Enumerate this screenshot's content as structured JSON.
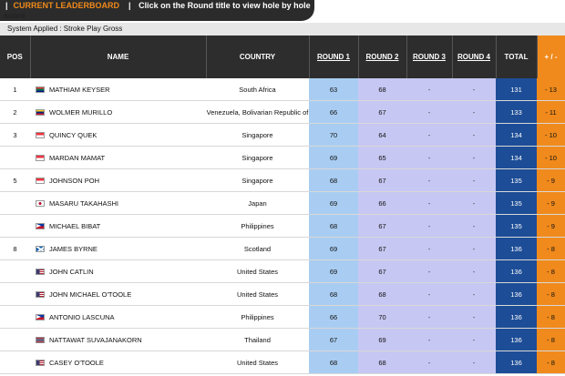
{
  "header": {
    "pipe": "|",
    "title": "CURRENT LEADERBOARD",
    "sep": "|",
    "hint_line1": "Click on the Round title to view hole by hole",
    "hint_line2": "score"
  },
  "system_applied": "System Applied : Stroke Play Gross",
  "columns": {
    "pos": "POS",
    "name": "NAME",
    "country": "COUNTRY",
    "r1": "ROUND 1",
    "r2": "ROUND 2",
    "r3": "ROUND 3",
    "r4": "ROUND 4",
    "total": "TOTAL",
    "pm": "+ / -"
  },
  "rows": [
    {
      "pos": "1",
      "flag": "za",
      "name": "MATHIAM KEYSER",
      "country": "South Africa",
      "r1": "63",
      "r2": "68",
      "r3": "-",
      "r4": "-",
      "total": "131",
      "pm": "- 13"
    },
    {
      "pos": "2",
      "flag": "ve",
      "name": "WOLMER MURILLO",
      "country": "Venezuela, Bolivarian Republic of",
      "r1": "66",
      "r2": "67",
      "r3": "-",
      "r4": "-",
      "total": "133",
      "pm": "- 11"
    },
    {
      "pos": "3",
      "flag": "sg",
      "name": "QUINCY QUEK",
      "country": "Singapore",
      "r1": "70",
      "r2": "64",
      "r3": "-",
      "r4": "-",
      "total": "134",
      "pm": "- 10"
    },
    {
      "pos": "",
      "flag": "sg",
      "name": "MARDAN MAMAT",
      "country": "Singapore",
      "r1": "69",
      "r2": "65",
      "r3": "-",
      "r4": "-",
      "total": "134",
      "pm": "- 10"
    },
    {
      "pos": "5",
      "flag": "sg",
      "name": "JOHNSON POH",
      "country": "Singapore",
      "r1": "68",
      "r2": "67",
      "r3": "-",
      "r4": "-",
      "total": "135",
      "pm": "- 9"
    },
    {
      "pos": "",
      "flag": "jp",
      "name": "MASARU TAKAHASHI",
      "country": "Japan",
      "r1": "69",
      "r2": "66",
      "r3": "-",
      "r4": "-",
      "total": "135",
      "pm": "- 9"
    },
    {
      "pos": "",
      "flag": "ph",
      "name": "MICHAEL BIBAT",
      "country": "Philippines",
      "r1": "68",
      "r2": "67",
      "r3": "-",
      "r4": "-",
      "total": "135",
      "pm": "- 9"
    },
    {
      "pos": "8",
      "flag": "gb-sct",
      "name": "JAMES BYRNE",
      "country": "Scotland",
      "r1": "69",
      "r2": "67",
      "r3": "-",
      "r4": "-",
      "total": "136",
      "pm": "- 8"
    },
    {
      "pos": "",
      "flag": "us",
      "name": "JOHN CATLIN",
      "country": "United States",
      "r1": "69",
      "r2": "67",
      "r3": "-",
      "r4": "-",
      "total": "136",
      "pm": "- 8"
    },
    {
      "pos": "",
      "flag": "us",
      "name": "JOHN MICHAEL O'TOOLE",
      "country": "United States",
      "r1": "68",
      "r2": "68",
      "r3": "-",
      "r4": "-",
      "total": "136",
      "pm": "- 8"
    },
    {
      "pos": "",
      "flag": "ph",
      "name": "ANTONIO LASCUNA",
      "country": "Philippines",
      "r1": "66",
      "r2": "70",
      "r3": "-",
      "r4": "-",
      "total": "136",
      "pm": "- 8"
    },
    {
      "pos": "",
      "flag": "th",
      "name": "NATTAWAT SUVAJANAKORN",
      "country": "Thailand",
      "r1": "67",
      "r2": "69",
      "r3": "-",
      "r4": "-",
      "total": "136",
      "pm": "- 8"
    },
    {
      "pos": "",
      "flag": "us",
      "name": "CASEY O'TOOLE",
      "country": "United States",
      "r1": "68",
      "r2": "68",
      "r3": "-",
      "r4": "-",
      "total": "136",
      "pm": "- 8"
    }
  ]
}
